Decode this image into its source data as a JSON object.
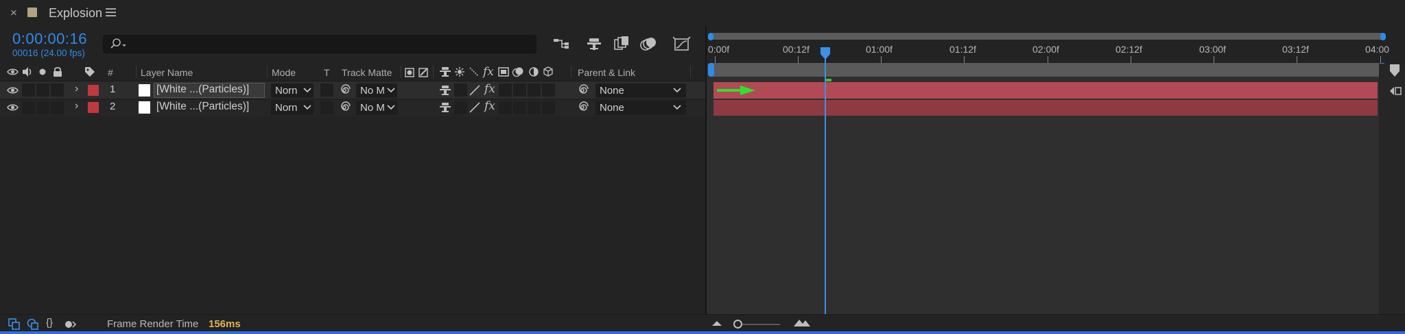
{
  "tab": {
    "title": "Explosion"
  },
  "header": {
    "timecode": "0:00:00:16",
    "frames": "00016 (24.00 fps)"
  },
  "columns": {
    "number": "#",
    "layer_name": "Layer Name",
    "mode": "Mode",
    "t": "T",
    "track_matte": "Track Matte",
    "parent_link": "Parent & Link"
  },
  "layers": [
    {
      "number": "1",
      "name": "[White ...(Particles)]",
      "label_color": "#c0393f",
      "mode": "Norn",
      "matte": "No M",
      "parent": "None"
    },
    {
      "number": "2",
      "name": "[White ...(Particles)]",
      "label_color": "#c0393f",
      "mode": "Norn",
      "matte": "No M",
      "parent": "None"
    }
  ],
  "ruler": {
    "labels": [
      {
        "text": "0:00f"
      },
      {
        "text": "00:12f"
      },
      {
        "text": "01:00f"
      },
      {
        "text": "01:12f"
      },
      {
        "text": "02:00f"
      },
      {
        "text": "02:12f"
      },
      {
        "text": "03:00f"
      },
      {
        "text": "03:12f"
      },
      {
        "text": "04:00"
      }
    ]
  },
  "footer": {
    "frame_render_label": "Frame Render Time",
    "frame_render_value": "156ms"
  },
  "colors": {
    "accent": "#2d8ceb",
    "layer_bar": "#b24a55",
    "render_value": "#e3b24d"
  }
}
